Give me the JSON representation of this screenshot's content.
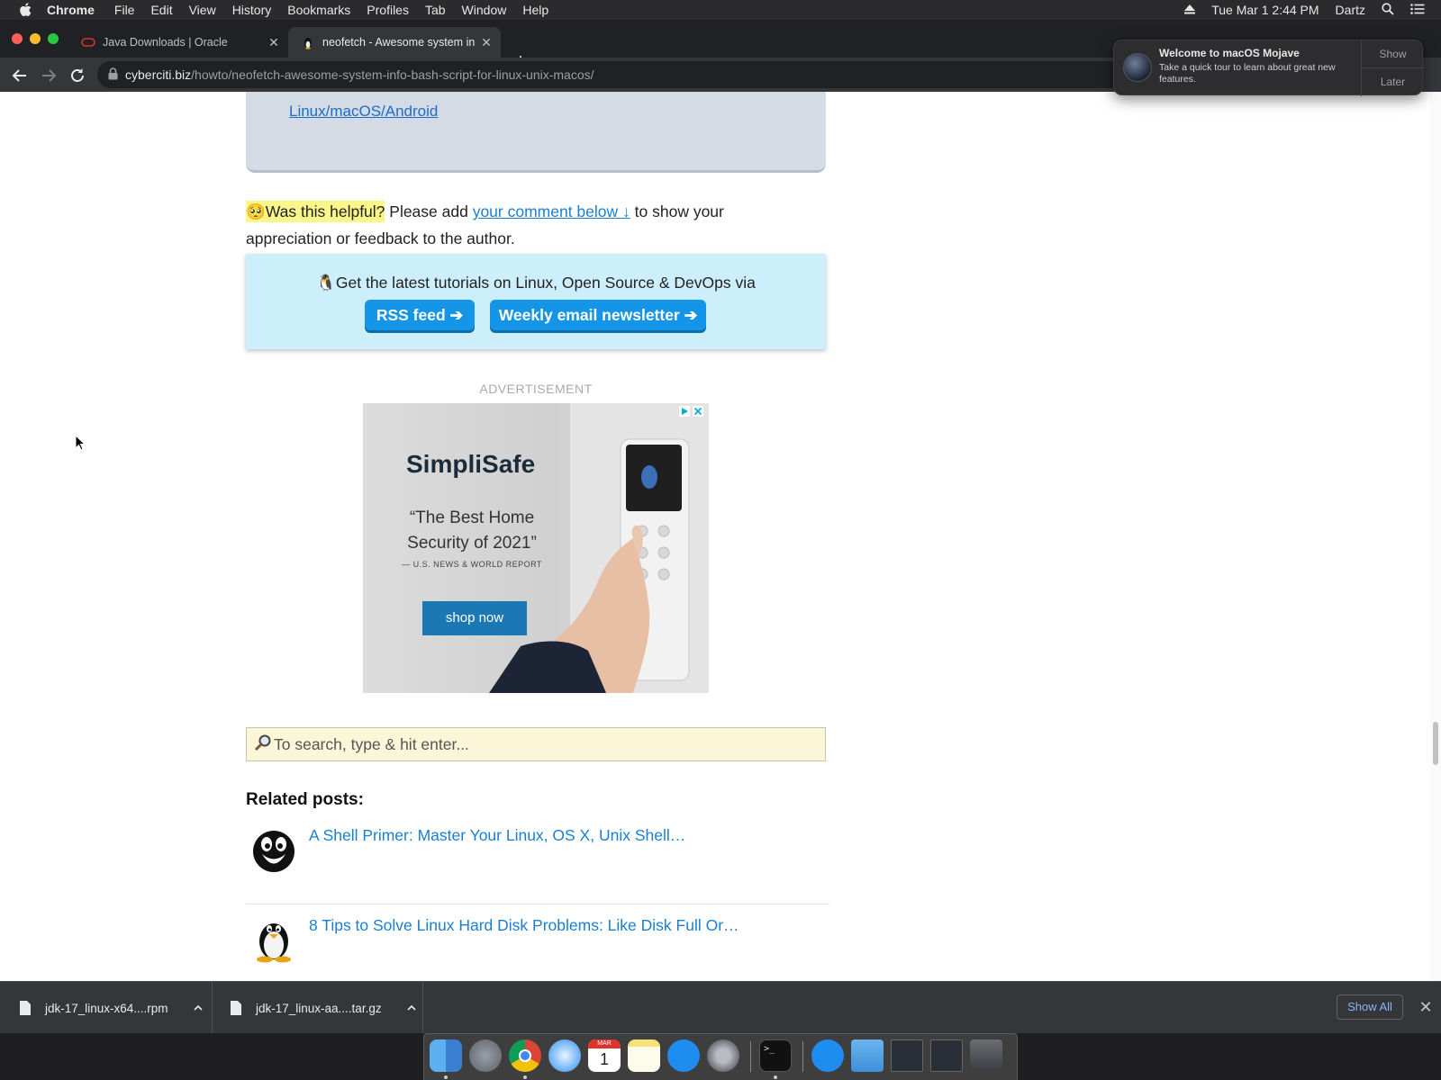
{
  "menubar": {
    "app_name": "Chrome",
    "menus": [
      "File",
      "Edit",
      "View",
      "History",
      "Bookmarks",
      "Profiles",
      "Tab",
      "Window",
      "Help"
    ],
    "datetime": "Tue Mar 1  2:44 PM",
    "user": "Dartz"
  },
  "tabs": [
    {
      "title": "Java Downloads | Oracle",
      "active": false
    },
    {
      "title": "neofetch - Awesome system in",
      "active": true
    }
  ],
  "omnibox": {
    "host": "cyberciti.biz",
    "path": "/howto/neofetch-awesome-system-info-bash-script-for-linux-unix-macos/"
  },
  "notification": {
    "title": "Welcome to macOS Mojave",
    "body": "Take a quick tour to learn about great new features.",
    "show_label": "Show",
    "later_label": "Later"
  },
  "article": {
    "top_link": "Linux/macOS/Android",
    "helpful_emoji": "🥺",
    "helpful_highlight": "Was this helpful?",
    "helpful_pre": " Please add ",
    "helpful_link": "your comment below ↓",
    "helpful_post": " to show your appreciation or feedback to the author.",
    "subscribe_emoji": "🐧",
    "subscribe_text": "Get the latest tutorials on Linux, Open Source & DevOps via",
    "rss_label": "RSS feed ➔",
    "newsletter_label": "Weekly email newsletter ➔"
  },
  "ad": {
    "label": "ADVERTISEMENT",
    "brand": "SimpliSafe",
    "quote": "“The Best Home Security of 2021”",
    "source": "— U.S. NEWS & WORLD REPORT",
    "cta": "shop now"
  },
  "search": {
    "placeholder": "To search, type & hit enter..."
  },
  "related": {
    "heading": "Related posts:",
    "posts": [
      {
        "title": "A Shell Primer: Master Your Linux, OS X, Unix Shell…"
      },
      {
        "title": "8 Tips to Solve Linux Hard Disk Problems: Like Disk Full Or…"
      }
    ]
  },
  "downloads": {
    "items": [
      {
        "name": "jdk-17_linux-x64....rpm"
      },
      {
        "name": "jdk-17_linux-aa....tar.gz"
      }
    ],
    "show_all_label": "Show All"
  },
  "dock": {
    "apps": [
      "finder-icon",
      "launchpad-icon",
      "chrome-icon",
      "safari-icon",
      "calendar-icon",
      "notes-icon",
      "app-store-icon",
      "system-preferences-icon",
      "terminal-icon",
      "app-store-downloads-icon",
      "folder-icon",
      "window-thumbnail-icon",
      "window-thumbnail-icon",
      "trash-icon"
    ],
    "calendar_month": "MAR",
    "calendar_day": "1"
  },
  "colors": {
    "link": "#1a7fd0",
    "button": "#1495e8",
    "highlight": "#fbf68a",
    "subscribe_bg": "#cdeefb"
  }
}
